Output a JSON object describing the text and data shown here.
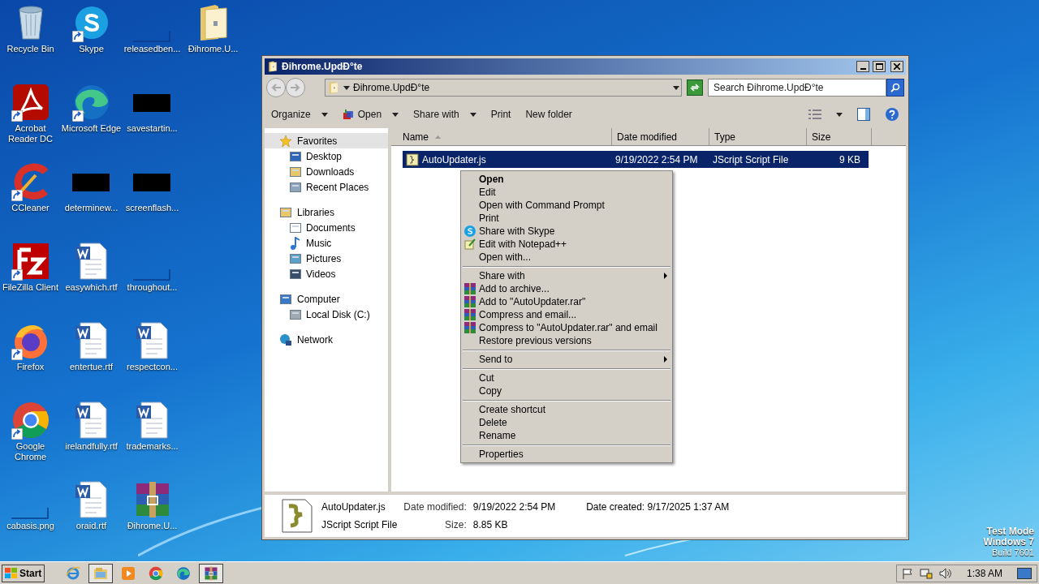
{
  "desktop_icons": [
    {
      "label": "Recycle Bin",
      "kind": "recycle",
      "shortcut": false
    },
    {
      "label": "Acrobat Reader DC",
      "kind": "acrobat",
      "shortcut": true
    },
    {
      "label": "CCleaner",
      "kind": "ccleaner",
      "shortcut": true
    },
    {
      "label": "FileZilla Client",
      "kind": "filezilla",
      "shortcut": true
    },
    {
      "label": "Firefox",
      "kind": "firefox",
      "shortcut": true
    },
    {
      "label": "Google Chrome",
      "kind": "chrome",
      "shortcut": true
    },
    {
      "label": "cabasis.png",
      "kind": "blank",
      "shortcut": false
    },
    {
      "label": "Skype",
      "kind": "skype",
      "shortcut": true
    },
    {
      "label": "Microsoft Edge",
      "kind": "edge",
      "shortcut": true
    },
    {
      "label": "determinew...",
      "kind": "redacted",
      "shortcut": false
    },
    {
      "label": "easywhich.rtf",
      "kind": "word",
      "shortcut": false
    },
    {
      "label": "entertue.rtf",
      "kind": "word",
      "shortcut": false
    },
    {
      "label": "irelandfully.rtf",
      "kind": "word",
      "shortcut": false
    },
    {
      "label": "oraid.rtf",
      "kind": "word",
      "shortcut": false
    },
    {
      "label": "releasedben...",
      "kind": "blank",
      "shortcut": false
    },
    {
      "label": "savestartin...",
      "kind": "redacted",
      "shortcut": false
    },
    {
      "label": "screenflash...",
      "kind": "redacted",
      "shortcut": false
    },
    {
      "label": "throughout...",
      "kind": "blank",
      "shortcut": false
    },
    {
      "label": "respectcon...",
      "kind": "word",
      "shortcut": false
    },
    {
      "label": "trademarks...",
      "kind": "word",
      "shortcut": false
    },
    {
      "label": "Đihrome.U...",
      "kind": "winrar",
      "shortcut": false
    },
    {
      "label": "Đihrome.U...",
      "kind": "folder",
      "shortcut": false
    }
  ],
  "window": {
    "title": "Đihrome.UpdÐ°te",
    "address": "Đihrome.UpdÐ°te",
    "search": {
      "placeholder": "Search Đihrome.UpdÐ°te"
    },
    "toolbar": [
      {
        "label": "Organize",
        "dropdown": true,
        "icon": false
      },
      {
        "label": "Open",
        "dropdown": true,
        "icon": true
      },
      {
        "label": "Share with",
        "dropdown": true,
        "icon": false
      },
      {
        "label": "Print",
        "dropdown": false,
        "icon": false
      },
      {
        "label": "New folder",
        "dropdown": false,
        "icon": false
      }
    ],
    "nav": [
      {
        "label": "Favorites",
        "kind": "star",
        "selected": true,
        "children": [
          {
            "label": "Desktop",
            "kind": "desktop"
          },
          {
            "label": "Downloads",
            "kind": "downloads"
          },
          {
            "label": "Recent Places",
            "kind": "recent"
          }
        ]
      },
      {
        "label": "Libraries",
        "kind": "libraries",
        "selected": false,
        "children": [
          {
            "label": "Documents",
            "kind": "documents"
          },
          {
            "label": "Music",
            "kind": "music"
          },
          {
            "label": "Pictures",
            "kind": "pictures"
          },
          {
            "label": "Videos",
            "kind": "videos"
          }
        ]
      },
      {
        "label": "Computer",
        "kind": "computer",
        "selected": false,
        "children": [
          {
            "label": "Local Disk (C:)",
            "kind": "disk"
          }
        ]
      },
      {
        "label": "Network",
        "kind": "network",
        "selected": false
      }
    ],
    "columns": [
      {
        "label": "Name",
        "sorted": true
      },
      {
        "label": "Date modified",
        "sorted": false
      },
      {
        "label": "Type",
        "sorted": false
      },
      {
        "label": "Size",
        "sorted": false
      }
    ],
    "files": [
      {
        "name": "AutoUpdater.js",
        "date_modified": "9/19/2022 2:54 PM",
        "type": "JScript Script File",
        "size": "9 KB",
        "selected": true
      }
    ],
    "details": {
      "name": "AutoUpdater.js",
      "type": "JScript Script File",
      "date_modified_label": "Date modified:",
      "date_modified": "9/19/2022 2:54 PM",
      "date_created_label": "Date created:",
      "date_created": "9/17/2025 1:37 AM",
      "size_label": "Size:",
      "size": "8.85 KB"
    }
  },
  "context_menu": [
    {
      "kind": "item",
      "label": "Open",
      "default": true,
      "submenu": false
    },
    {
      "kind": "item",
      "label": "Edit",
      "default": false,
      "submenu": false
    },
    {
      "kind": "item",
      "label": "Open with Command Prompt",
      "default": false,
      "submenu": false
    },
    {
      "kind": "item",
      "label": "Print",
      "default": false,
      "submenu": false
    },
    {
      "kind": "skype",
      "label": "Share with Skype",
      "default": false,
      "submenu": false
    },
    {
      "kind": "notepad",
      "label": "Edit with Notepad++",
      "default": false,
      "submenu": false
    },
    {
      "kind": "item",
      "label": "Open with...",
      "default": false,
      "submenu": false
    },
    {
      "kind": "separator"
    },
    {
      "kind": "item",
      "label": "Share with",
      "default": false,
      "submenu": true
    },
    {
      "kind": "winrar",
      "label": "Add to archive...",
      "default": false,
      "submenu": false
    },
    {
      "kind": "winrar",
      "label": "Add to \"AutoUpdater.rar\"",
      "default": false,
      "submenu": false
    },
    {
      "kind": "winrar",
      "label": "Compress and email...",
      "default": false,
      "submenu": false
    },
    {
      "kind": "winrar",
      "label": "Compress to \"AutoUpdater.rar\" and email",
      "default": false,
      "submenu": false
    },
    {
      "kind": "item",
      "label": "Restore previous versions",
      "default": false,
      "submenu": false
    },
    {
      "kind": "separator"
    },
    {
      "kind": "item",
      "label": "Send to",
      "default": false,
      "submenu": true
    },
    {
      "kind": "separator"
    },
    {
      "kind": "item",
      "label": "Cut",
      "default": false,
      "submenu": false
    },
    {
      "kind": "item",
      "label": "Copy",
      "default": false,
      "submenu": false
    },
    {
      "kind": "separator"
    },
    {
      "kind": "item",
      "label": "Create shortcut",
      "default": false,
      "submenu": false
    },
    {
      "kind": "item",
      "label": "Delete",
      "default": false,
      "submenu": false
    },
    {
      "kind": "item",
      "label": "Rename",
      "default": false,
      "submenu": false
    },
    {
      "kind": "separator"
    },
    {
      "kind": "item",
      "label": "Properties",
      "default": false,
      "submenu": false
    }
  ],
  "os_notice": [
    "Test Mode",
    "Windows 7",
    "Build 7601"
  ],
  "taskbar": {
    "start": "Start",
    "pinned": [
      {
        "kind": "ie",
        "selected": false
      },
      {
        "kind": "explorer",
        "selected": true
      },
      {
        "kind": "media",
        "selected": false
      },
      {
        "kind": "chrome",
        "selected": false
      },
      {
        "kind": "edge",
        "selected": false
      },
      {
        "kind": "winrar",
        "selected": true
      }
    ],
    "clock": "1:38 AM"
  }
}
